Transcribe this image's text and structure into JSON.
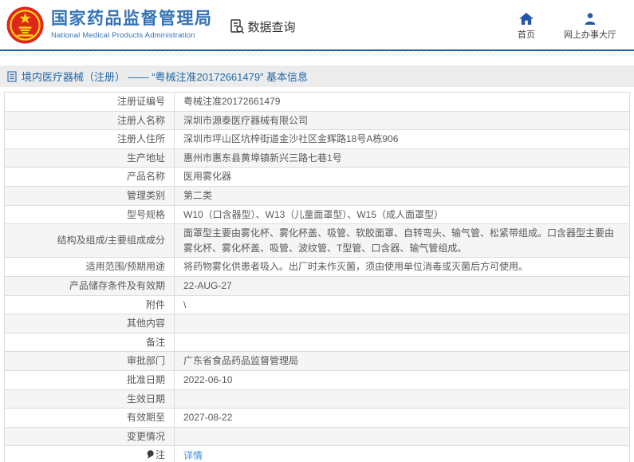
{
  "header": {
    "org_name": "国家药品监督管理局",
    "org_name_en": "National Medical Products Administration",
    "nav_data_query": "数据查询",
    "nav_home": "首页",
    "nav_hall": "网上办事大厅"
  },
  "title_bar": {
    "text": "境内医疗器械（注册） ——  “粤械注准20172661479”  基本信息"
  },
  "table": {
    "rows": [
      {
        "label": "注册证编号",
        "value": "粤械注准20172661479"
      },
      {
        "label": "注册人名称",
        "value": "深圳市源泰医疗器械有限公司"
      },
      {
        "label": "注册人住所",
        "value": "深圳市坪山区坑梓街道金沙社区金辉路18号A栋906"
      },
      {
        "label": "生产地址",
        "value": "惠州市惠东县黄埠镇新兴三路七巷1号"
      },
      {
        "label": "产品名称",
        "value": "医用雾化器"
      },
      {
        "label": "管理类别",
        "value": "第二类"
      },
      {
        "label": "型号规格",
        "value": "W10（口含器型）、W13（儿童面罩型）、W15（成人面罩型）"
      },
      {
        "label": "结构及组成/主要组成成分",
        "value": "面罩型主要由雾化杯、雾化杯盖、吸管、软胶面罩、自转弯头、输气管、松紧带组成。口含器型主要由雾化杯、雾化杯盖、吸管、波纹管、T型管、口含器、输气管组成。"
      },
      {
        "label": "适用范围/预期用途",
        "value": "将药物雾化供患者吸入。出厂时未作灭菌，须由使用单位消毒或灭菌后方可使用。"
      },
      {
        "label": "产品储存条件及有效期",
        "value": "22-AUG-27"
      },
      {
        "label": "附件",
        "value": "\\"
      },
      {
        "label": "其他内容",
        "value": ""
      },
      {
        "label": "备注",
        "value": ""
      },
      {
        "label": "审批部门",
        "value": "广东省食品药品监督管理局"
      },
      {
        "label": "批准日期",
        "value": "2022-06-10"
      },
      {
        "label": "生效日期",
        "value": ""
      },
      {
        "label": "有效期至",
        "value": "2027-08-22"
      },
      {
        "label": "变更情况",
        "value": ""
      },
      {
        "label": "注",
        "value": "详情"
      }
    ]
  },
  "colors": {
    "brand_blue": "#3473b5",
    "header_rule_blue": "#1e63a6",
    "title_text_blue": "#2368a9",
    "title_bar_bg": "#ececec",
    "nav_icon_blue": "#2357a5",
    "link_blue": "#3e8ede",
    "row_alt_gray": "#f5f5f5",
    "emblem_red": "#e0251b",
    "emblem_yellow": "#f9d616"
  }
}
